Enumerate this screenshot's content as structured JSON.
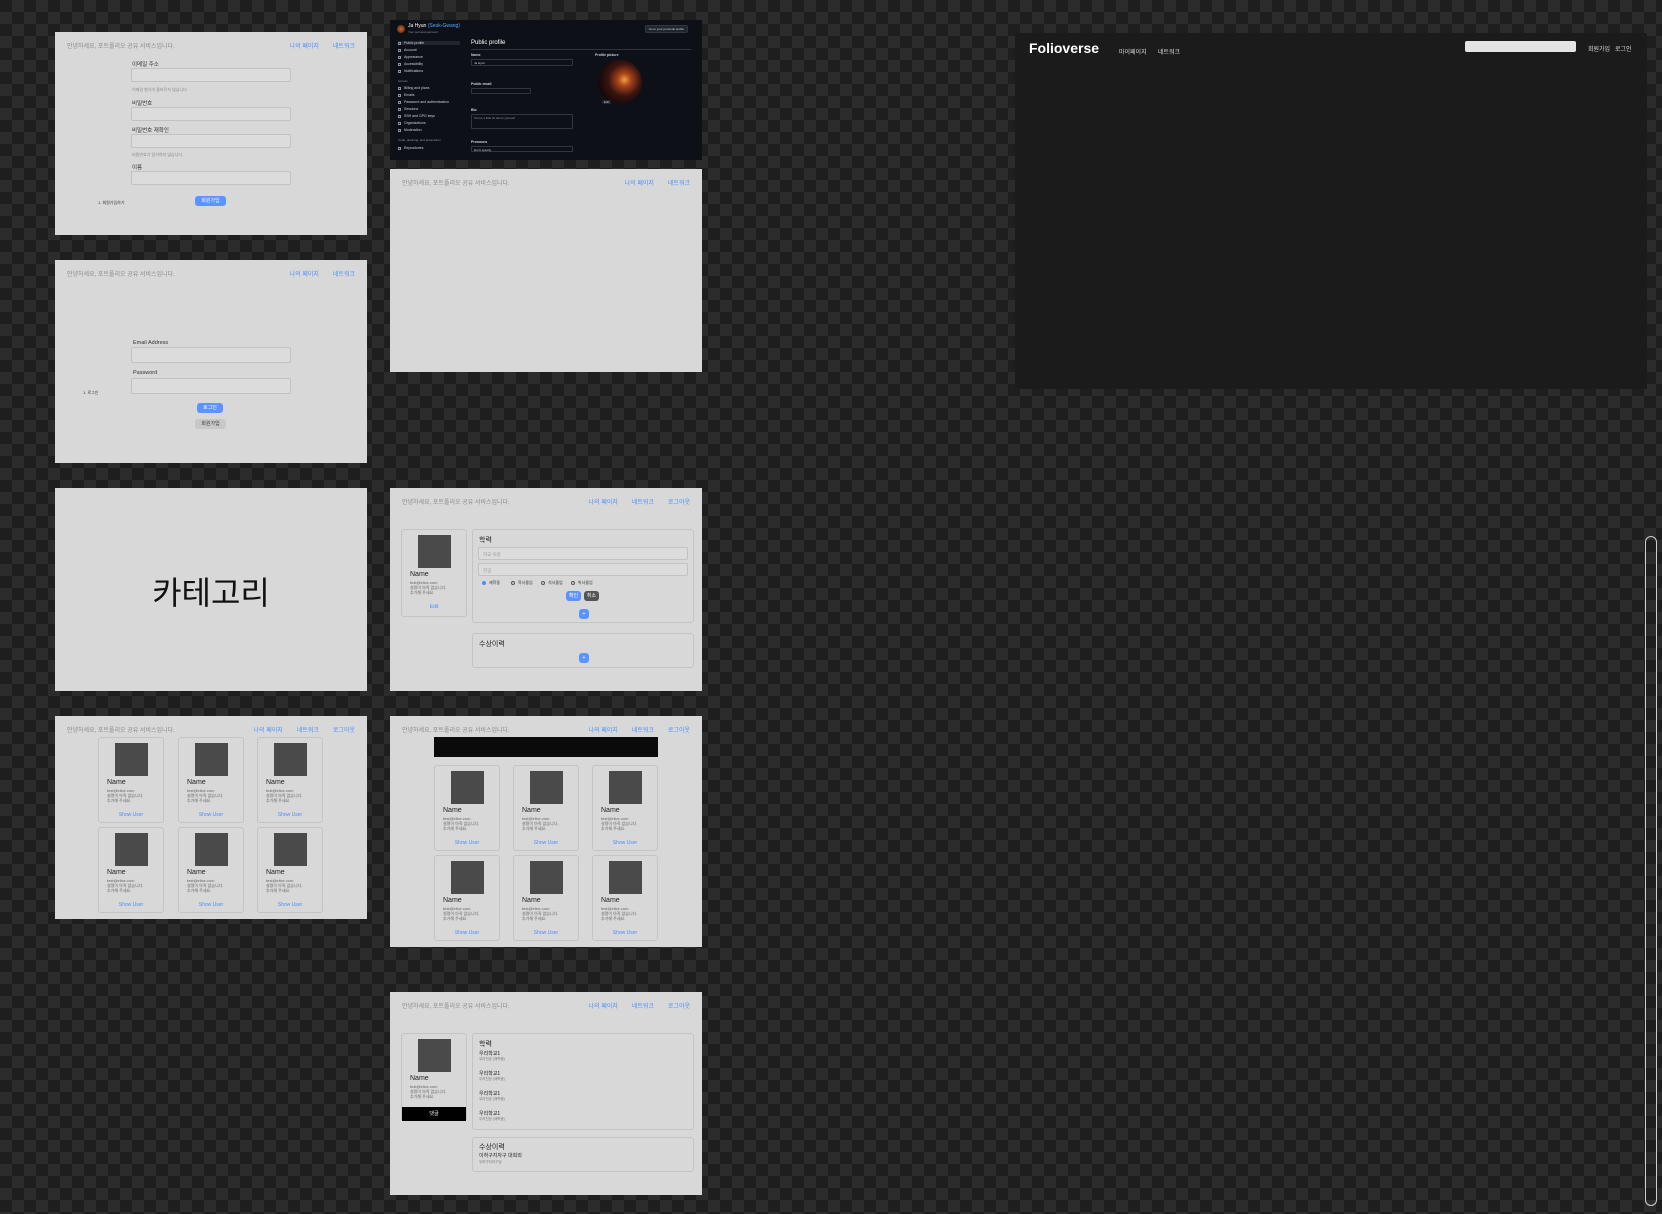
{
  "common": {
    "greeting": "안녕하세요, 포트폴리오 공유 서비스입니다.",
    "nav_mypage": "나의 페이지",
    "nav_network": "네트워크",
    "nav_logout": "로그아웃"
  },
  "signup": {
    "email_label": "이메일 주소",
    "email_hint": "이메일 형식이 올바르지 않습니다.",
    "password_label": "비밀번호",
    "password_confirm_label": "비밀번호 재확인",
    "password_confirm_hint": "비밀번호가 일치하지 않습니다.",
    "name_label": "이름",
    "submit": "회원가입",
    "note": "1. 회원가입하기"
  },
  "login": {
    "email_label": "Email Address",
    "password_label": "Password",
    "login_button": "로그인",
    "signup_button": "회원가입",
    "note": "1. 로그인"
  },
  "category": {
    "title": "카테고리"
  },
  "user_card": {
    "name": "Name",
    "email": "test@elice.com",
    "desc1": "설명이 아직 없습니다.",
    "desc2": "추가해 주세요.",
    "show": "Show User",
    "edit": "Edit"
  },
  "mypage_edit": {
    "edu_title": "학력",
    "school_placeholder": "학교 이름",
    "major_placeholder": "전공",
    "radio_options": [
      "재학중",
      "학사졸업",
      "석사졸업",
      "박사졸업"
    ],
    "confirm": "확인",
    "cancel": "취소",
    "add": "+",
    "award_title": "수상이력"
  },
  "userpage": {
    "edu_title": "학력",
    "schools": [
      {
        "name": "우리학교1",
        "sub": "우리전공 (재학중)"
      },
      {
        "name": "우리학교1",
        "sub": "우리전공 (재학중)"
      },
      {
        "name": "우리학교1",
        "sub": "우리전공 (재학중)"
      },
      {
        "name": "우리학교1",
        "sub": "우리전공 (재학중)"
      }
    ],
    "award_title": "수상이력",
    "award_name": "이하구지자구 대회외",
    "award_sub": "우하구지자구입",
    "comment_button": "댓글"
  },
  "github": {
    "user": "Ja Hyun",
    "user_sub": "(Seuk-Gwang)",
    "user_caption": "Your personal account",
    "goto_button": "Go to your personal profile",
    "sidebar": [
      "Public profile",
      "Account",
      "Appearance",
      "Accessibility",
      "Notifications"
    ],
    "access_title": "Access",
    "access_items": [
      "Billing and plans",
      "Emails",
      "Password and authentication",
      "Sessions",
      "SSH and GPG keys",
      "Organizations",
      "Moderation"
    ],
    "code_title": "Code, planning, and automation",
    "code_items": [
      "Repositories"
    ],
    "main_title": "Public profile",
    "name_label": "Name",
    "name_value": "Ja Hyun",
    "public_email_label": "Public email",
    "bio_label": "Bio",
    "bio_placeholder": "Tell us a little bit about yourself",
    "pronouns_label": "Pronouns",
    "pronouns_value": "Don't specify",
    "picture_label": "Profile picture",
    "edit_label": "Edit"
  },
  "folioverse": {
    "logo": "Folioverse",
    "nav1": "마이페이지",
    "nav2": "네트워크",
    "signup": "회원가입",
    "login": "로그인"
  }
}
